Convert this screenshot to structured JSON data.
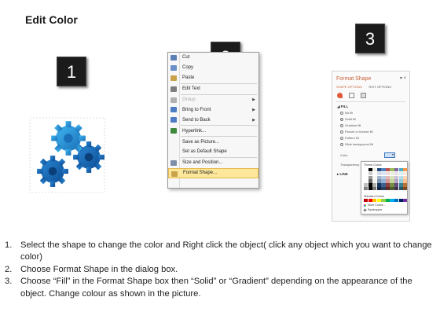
{
  "title": "Edit Color",
  "badges": [
    "1",
    "2",
    "3"
  ],
  "context_menu": {
    "items": [
      {
        "label": "Cut",
        "icon": "scissors-icon",
        "icon_color": "#5b7fb5",
        "disabled": false,
        "submenu": false,
        "highlight": false
      },
      {
        "label": "Copy",
        "icon": "copy-icon",
        "icon_color": "#6a8fc8",
        "disabled": false,
        "submenu": false,
        "highlight": false
      },
      {
        "label": "Paste",
        "icon": "paste-icon",
        "icon_color": "#c9a24a",
        "disabled": false,
        "submenu": false,
        "highlight": false
      },
      {
        "label": "Edit Text",
        "icon": "edit-text-icon",
        "icon_color": "#7d7d7d",
        "disabled": false,
        "submenu": false,
        "highlight": false
      },
      {
        "label": "Group",
        "icon": "group-icon",
        "icon_color": "#b0b0b0",
        "disabled": true,
        "submenu": true,
        "highlight": false
      },
      {
        "label": "Bring to Front",
        "icon": "bring-front-icon",
        "icon_color": "#4d7cc4",
        "disabled": false,
        "submenu": true,
        "highlight": false
      },
      {
        "label": "Send to Back",
        "icon": "send-back-icon",
        "icon_color": "#4d7cc4",
        "disabled": false,
        "submenu": true,
        "highlight": false
      },
      {
        "label": "Hyperlink...",
        "icon": "hyperlink-icon",
        "icon_color": "#3d8a3d",
        "disabled": false,
        "submenu": false,
        "highlight": false
      },
      {
        "label": "Save as Picture...",
        "icon": "none",
        "icon_color": "",
        "disabled": false,
        "submenu": false,
        "highlight": false
      },
      {
        "label": "Set as Default Shape",
        "icon": "none",
        "icon_color": "",
        "disabled": false,
        "submenu": false,
        "highlight": false
      },
      {
        "label": "Size and Position...",
        "icon": "size-position-icon",
        "icon_color": "#7d8fa8",
        "disabled": false,
        "submenu": false,
        "highlight": false
      },
      {
        "label": "Format Shape...",
        "icon": "format-shape-icon",
        "icon_color": "#c9a24a",
        "disabled": false,
        "submenu": false,
        "highlight": true
      }
    ]
  },
  "format_pane": {
    "title": "Format Shape",
    "tabs": [
      "SHAPE OPTIONS",
      "TEXT OPTIONS"
    ],
    "fill_section": "FILL",
    "fill_options": [
      "No fill",
      "Solid fill",
      "Gradient fill",
      "Picture or texture fill",
      "Pattern fill",
      "Slide background fill"
    ],
    "selected_fill": "Solid fill",
    "color_label": "Color",
    "transparency_label": "Transparency",
    "line_section": "LINE",
    "accent_color": "#c8623a"
  },
  "palette": {
    "theme_label": "Theme Colors",
    "standard_label": "Standard Colors",
    "more_colors": "More Colors...",
    "eyedropper": "Eyedropper",
    "theme_colors": [
      "#ffffff",
      "#000000",
      "#eeece1",
      "#1f497d",
      "#4f81bd",
      "#c0504d",
      "#9bbb59",
      "#8064a2",
      "#4bacc6",
      "#f79646"
    ],
    "standard_colors": [
      "#c00000",
      "#ff0000",
      "#ffc000",
      "#ffff00",
      "#92d050",
      "#00b050",
      "#00b0f0",
      "#0070c0",
      "#002060",
      "#7030a0"
    ]
  },
  "instructions": [
    {
      "num": "1.",
      "text": "Select the shape to change the color and Right click the object( click any object which you want to change color)"
    },
    {
      "num": "2.",
      "text": "Choose Format Shape in the dialog box."
    },
    {
      "num": "3.",
      "text": "Choose “Fill” in the Format Shape box then “Solid” or “Gradient” depending on the appearance of the object. Change colour as shown in the picture."
    }
  ]
}
